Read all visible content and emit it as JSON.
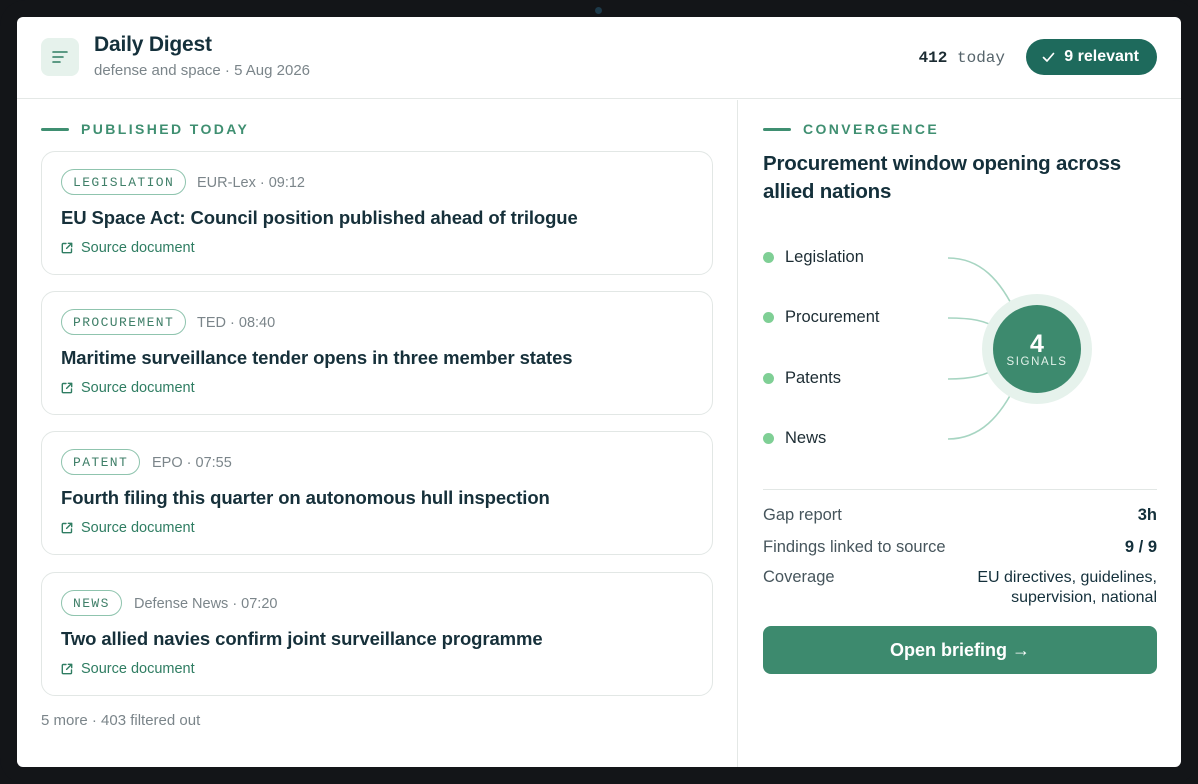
{
  "app": {
    "title": "Daily Digest",
    "subtitle": "defense and space · 5 Aug 2026",
    "count_number": "412",
    "count_suffix": " today",
    "relevant_label": "9 relevant"
  },
  "published": {
    "section_label": "PUBLISHED TODAY",
    "items": [
      {
        "tag": "LEGISLATION",
        "meta": "EUR-Lex · 09:12",
        "title": "EU Space Act: Council position published ahead of trilogue",
        "source_label": "Source document"
      },
      {
        "tag": "PROCUREMENT",
        "meta": "TED · 08:40",
        "title": "Maritime surveillance tender opens in three member states",
        "source_label": "Source document"
      },
      {
        "tag": "PATENT",
        "meta": "EPO · 07:55",
        "title": "Fourth filing this quarter on autonomous hull inspection",
        "source_label": "Source document"
      },
      {
        "tag": "NEWS",
        "meta": "Defense News · 07:20",
        "title": "Two allied navies confirm joint surveillance programme",
        "source_label": "Source document"
      }
    ],
    "more_text": "5 more · 403 filtered out"
  },
  "convergence": {
    "section_label": "CONVERGENCE",
    "title": "Procurement window opening across allied nations",
    "signals": [
      "Legislation",
      "Procurement",
      "Patents",
      "News"
    ],
    "hub_count": "4",
    "hub_label": "SIGNALS",
    "stats": {
      "gap_label": "Gap report",
      "gap_value": "3h",
      "findings_label": "Findings linked to source",
      "findings_value": "9 / 9",
      "coverage_label": "Coverage",
      "coverage_line1": "EU directives, guidelines,",
      "coverage_line2": "supervision, national"
    },
    "open_button": "Open briefing →"
  },
  "colors": {
    "accent": "#3d8a6e",
    "accent_dark": "#1e6a5c",
    "signal_dot": "#7fcf95"
  }
}
